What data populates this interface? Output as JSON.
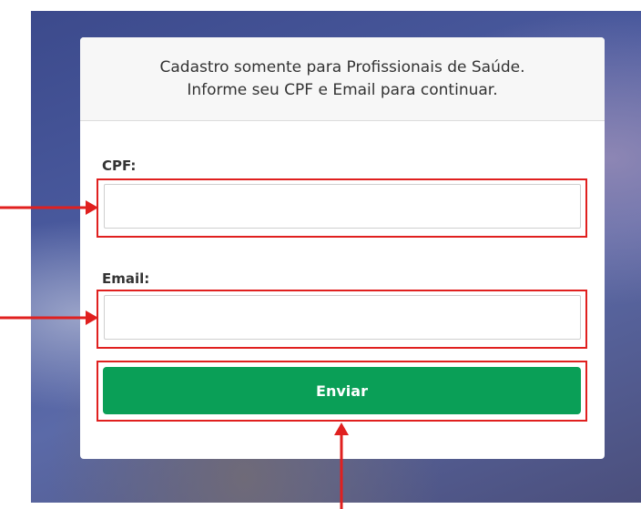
{
  "form": {
    "header_line1": "Cadastro somente para Profissionais de Saúde.",
    "header_line2": "Informe seu CPF e Email para continuar.",
    "cpf_label": "CPF:",
    "cpf_value": "",
    "email_label": "Email:",
    "email_value": "",
    "submit_label": "Enviar"
  },
  "colors": {
    "accent_button": "#0a9f57",
    "annotation": "#e0201f"
  }
}
